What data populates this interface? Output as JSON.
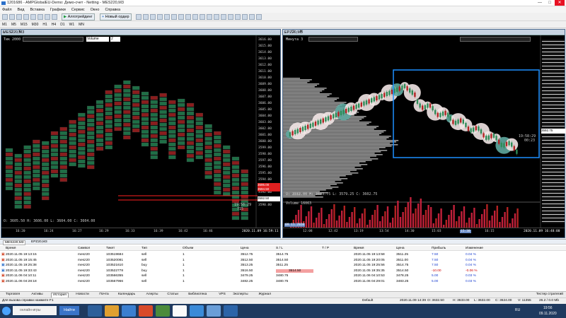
{
  "app": {
    "title": "1201686 - AMPGlobalEU-Demo: Демо-счет - Netting - MES220,M3",
    "window_controls": [
      "—",
      "□",
      "✕"
    ]
  },
  "menu": [
    "Файл",
    "Вид",
    "Вставка",
    "Графики",
    "Сервис",
    "Окно",
    "Справка"
  ],
  "toolbar": {
    "algo_label": "Алготрейдинг",
    "new_order_label": "Новый ордер"
  },
  "timeframes": [
    "M1",
    "M5",
    "M15",
    "M30",
    "H1",
    "H4",
    "D1",
    "W1",
    "MN"
  ],
  "left_chart": {
    "window_title": "MES220,M3",
    "mode": "Тик  2000",
    "volume_select": "Volume",
    "volume_count": "2",
    "ohlc": "O: 3605.50   H: 3606.00   L: 3604.00   C: 3604.00",
    "price_ticks": [
      "3616.00",
      "3615.00",
      "3614.00",
      "3613.00",
      "3612.00",
      "3611.00",
      "3610.00",
      "3609.00",
      "3608.00",
      "3607.00",
      "3606.00",
      "3605.00",
      "3604.00",
      "3603.00",
      "3602.00",
      "3601.00",
      "3600.00",
      "3599.00",
      "3598.00",
      "3597.00",
      "3596.00",
      "3595.00",
      "3594.00",
      "3593.00",
      "3592.00",
      "3591.00",
      "3590.00"
    ],
    "time_ticks": [
      "16:20",
      "16:24",
      "16:27",
      "16:29",
      "16:33",
      "16:39",
      "16:42",
      "16:46"
    ],
    "date_label": "2020.11.09 16:59:11",
    "red_line_price_1": "3595.00",
    "red_line_price_2": "3594.50",
    "current_price": "3592.50",
    "timer": "19:58:29",
    "timer_sub": "715"
  },
  "right_chart": {
    "window_title": "EPZ20,M3",
    "mode": "Минута  3",
    "ohlc": "O: 3583.00   H: 3603.75   L: 3579.25   C: 3602.75",
    "volume_label": "Volume 16063",
    "countdown": "19:58:29",
    "countdown_sub": "00:23",
    "current_price": "3592.75",
    "time_ticks": [
      "12:08",
      "12:42",
      "13:19",
      "13:54",
      "14:30",
      "15:03",
      "15:38",
      "16:15"
    ],
    "date_label": "2020.11.09 16:48:00",
    "left_date": "09.11.2020"
  },
  "terminal": {
    "columns": [
      "Время",
      "Символ",
      "Тикет",
      "Тип",
      "Объем",
      "Цена",
      "S / L",
      "T / P",
      "Время",
      "Цена",
      "Прибыль",
      "Изменение"
    ],
    "rows": [
      [
        "2020.11.05 19:13:15",
        "mesz20",
        "103519684",
        "sell",
        "1",
        "3512.75",
        "3514.75",
        "",
        "2020.11.05 19:13:58",
        "3511.25",
        "7.50",
        "0.04 %"
      ],
      [
        "2020.11.05 19:15:45",
        "mesz20",
        "103520081",
        "sell",
        "1",
        "3512.50",
        "3514.50",
        "",
        "2020.11.05 19:20:05",
        "3511.00",
        "7.50",
        "0.04 %"
      ],
      [
        "2020.11.05 19:25:38",
        "mesz20",
        "103521610",
        "buy",
        "1",
        "3513.25",
        "3511.25",
        "",
        "2020.11.05 19:25:56",
        "3514.75",
        "7.50",
        "0.04 %"
      ],
      [
        "2020.11.05 19:33:43",
        "mesz20",
        "103522778",
        "buy",
        "1",
        "3516.50",
        "3514.50",
        "",
        "2020.11.05 19:35:35",
        "3514.50",
        "-10.00",
        "-0.06 %"
      ],
      [
        "2020.11.06 04:10:11",
        "mesz20",
        "103566355",
        "sell",
        "1",
        "3479.25",
        "3480.75",
        "",
        "2020.11.06 04:10:53",
        "3478.25",
        "5.00",
        "0.03 %"
      ],
      [
        "2020.11.06 04:28:18",
        "mesz20",
        "103567966",
        "sell",
        "1",
        "3482.25",
        "3480.75",
        "",
        "2020.11.06 04:29:01",
        "3483.25",
        "5.00",
        "0.03 %"
      ]
    ],
    "tabs": [
      "Торговля",
      "Активы",
      "История",
      "Новости",
      "Почта",
      "Календарь",
      "Алерты",
      "Статьи",
      "Библиотека",
      "VPS",
      "Эксперты",
      "Журнал"
    ],
    "active_tab": "История",
    "strategy_tester": "Тестер стратегий"
  },
  "status": {
    "help": "Для вызова справки нажмите F1",
    "profile": "Default",
    "datetime": "2020.11.09 14:39",
    "o": "O: 3632.50",
    "h": "H: 3633.00",
    "l": "L: 3632.00",
    "c": "C: 3624.00",
    "v": "V: 11355",
    "net": "26.2 / 0.0 Mb"
  },
  "taskbar": {
    "search_placeholder": "онлайн-игры",
    "search_button": "Найти",
    "lang": "RU",
    "clock_time": "19:56",
    "clock_date": "09.11.2020"
  },
  "colors": {
    "chart_bg": "#000000",
    "bull": "#2e8b57",
    "bear": "#b22222",
    "selection_box": "#1e90ff",
    "profile": "#bbbbbb",
    "window_frame": "#4d6b8f"
  }
}
